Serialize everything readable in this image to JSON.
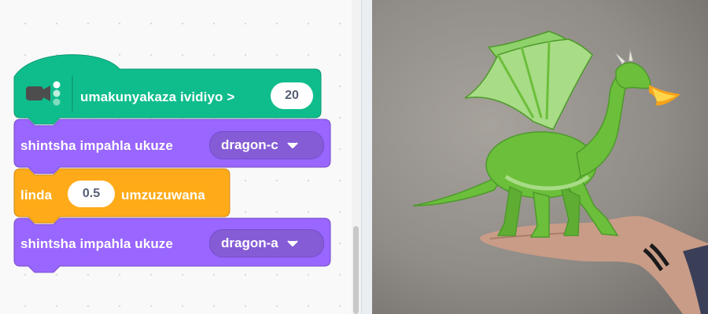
{
  "blocks": {
    "hat": {
      "extension": "video-sensing",
      "icon": "video-camera-icon",
      "label": "umakunyakaza ividiyo >",
      "value": "20",
      "color": "#0fbd8c"
    },
    "costume1": {
      "label": "shintsha impahla ukuze",
      "menu_value": "dragon-c",
      "color": "#9966ff"
    },
    "wait": {
      "label": "linda",
      "value": "0.5",
      "suffix": "umzuzuwana",
      "color": "#ffab19"
    },
    "costume2": {
      "label": "shintsha impahla ukuze",
      "menu_value": "dragon-a",
      "color": "#9966ff"
    }
  },
  "stage": {
    "sprite": "dragon",
    "background": "webcam-video-hand",
    "sprite_color": "#6cbf3b"
  }
}
